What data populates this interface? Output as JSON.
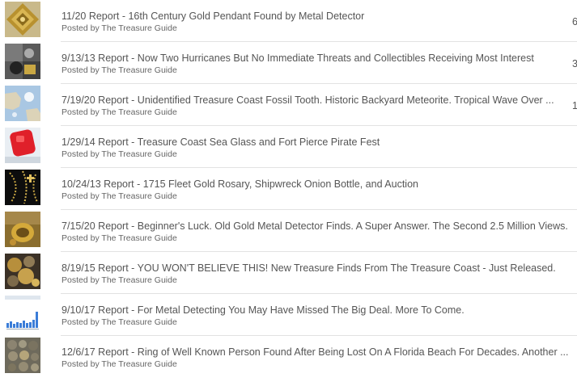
{
  "posts": [
    {
      "title": "11/20 Report - 16th Century Gold Pendant Found by Metal Detector",
      "byline": "Posted by The Treasure Guide",
      "count": "6",
      "thumbnail": "gold-pendant-thumbnail"
    },
    {
      "title": "9/13/13 Report - Now Two Hurricanes But No Immediate Threats and Collectibles Receiving Most Interest",
      "byline": "Posted by The Treasure Guide",
      "count": "3",
      "thumbnail": "collectibles-thumbnail"
    },
    {
      "title": "7/19/20 Report - Unidentified Treasure Coast Fossil Tooth. Historic Backyard Meteorite. Tropical Wave Over ...",
      "byline": "Posted by The Treasure Guide",
      "count": "1",
      "thumbnail": "weather-map-thumbnail"
    },
    {
      "title": "1/29/14 Report - Treasure Coast Sea Glass and Fort Pierce Pirate Fest",
      "byline": "Posted by The Treasure Guide",
      "count": "",
      "thumbnail": "sea-glass-thumbnail"
    },
    {
      "title": "10/24/13 Report - 1715 Fleet Gold Rosary, Shipwreck Onion Bottle, and Auction",
      "byline": "Posted by The Treasure Guide",
      "count": "",
      "thumbnail": "gold-rosary-thumbnail"
    },
    {
      "title": "7/15/20 Report - Beginner's Luck. Old Gold Metal Detector Finds. A Super Answer. The Second 2.5 Million Views.",
      "byline": "Posted by The Treasure Guide",
      "count": "",
      "thumbnail": "gold-ring-thumbnail"
    },
    {
      "title": "8/19/15 Report - YOU WON'T BELIEVE THIS! New Treasure Finds From The Treasure Coast - Just Released.",
      "byline": "Posted by The Treasure Guide",
      "count": "",
      "thumbnail": "treasure-finds-thumbnail"
    },
    {
      "title": "9/10/17 Report - For Metal Detecting You May Have Missed The Big Deal. More To Come.",
      "byline": "Posted by The Treasure Guide",
      "count": "",
      "thumbnail": "stats-chart-thumbnail"
    },
    {
      "title": "12/6/17 Report - Ring of Well Known Person Found After Being Lost On A Florida Beach For Decades. Another ...",
      "byline": "Posted by The Treasure Guide",
      "count": "",
      "thumbnail": "coins-thumbnail"
    }
  ],
  "colors": {
    "title_text": "#555555",
    "byline_text": "#666666",
    "divider": "#e2e2e2"
  }
}
